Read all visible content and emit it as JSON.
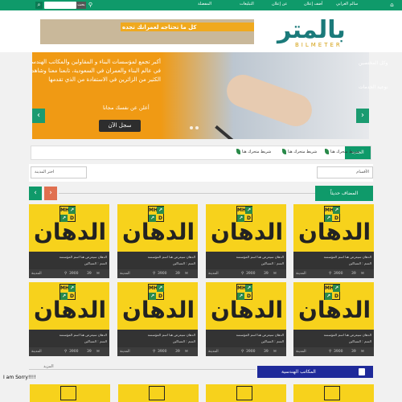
{
  "topbar": {
    "nav": [
      "سالم العرابي",
      "أضف إعلان",
      "عن إعلان",
      "التبليغات",
      "المفضلة"
    ],
    "search_placeholder": "",
    "search_button": "بحث"
  },
  "banner": {
    "text": "كل ما تحتاجه لعمرانك تجده"
  },
  "logo": {
    "main": "بالمتر",
    "sub": "BILMETER"
  },
  "slider": {
    "text": "أكبر تجمع لمؤسسات البناء و المقاولين والمكاتب الهندسية في عالم البناء والعمران في السعودية، تابعنا معنا وشاهد الكثير من الزائرين في الاستفادة من الذي تقدمها",
    "cta_text": "أعلن عن نفسك مجانا",
    "button": "سجل الآن",
    "side_text": "وكل المختصين",
    "side_text2": "نوعية الخدمات"
  },
  "ticker": {
    "label": "الجديد",
    "items": [
      "شريط متحرك هنا",
      "شريط متحرك هنا",
      "شريط متحرك هنا"
    ]
  },
  "filter": {
    "city": "اختر المدينة",
    "section": "الأقسام"
  },
  "section1": {
    "title": "المضاف حديثاً"
  },
  "cards": [
    {
      "title": "الدهان",
      "line1": "الدهان سيعرض هنا اسم المؤسسة",
      "line2": "السم : السباكين",
      "city": "المدينة",
      "views": "3900",
      "likes": "39"
    },
    {
      "title": "الدهان",
      "line1": "الدهان سيعرض هنا اسم المؤسسة",
      "line2": "السم : السباكين",
      "city": "المدينة",
      "views": "3900",
      "likes": "39"
    },
    {
      "title": "الدهان",
      "line1": "الدهان سيعرض هنا اسم المؤسسة",
      "line2": "السم : السباكين",
      "city": "المدينة",
      "views": "3900",
      "likes": "39"
    },
    {
      "title": "الدهان",
      "line1": "الدهان سيعرض هنا اسم المؤسسة",
      "line2": "السم : السباكين",
      "city": "المدينة",
      "views": "3900",
      "likes": "39"
    },
    {
      "title": "الدهان",
      "line1": "الدهان سيعرض هنا اسم المؤسسة",
      "line2": "السم : السباكين",
      "city": "المدينة",
      "views": "3900",
      "likes": "39"
    },
    {
      "title": "الدهان",
      "line1": "الدهان سيعرض هنا اسم المؤسسة",
      "line2": "السم : السباكين",
      "city": "المدينة",
      "views": "3900",
      "likes": "39"
    },
    {
      "title": "الدهان",
      "line1": "الدهان سيعرض هنا اسم المؤسسة",
      "line2": "السم : السباكين",
      "city": "المدينة",
      "views": "3900",
      "likes": "39"
    },
    {
      "title": "الدهان",
      "line1": "الدهان سيعرض هنا اسم المؤسسة",
      "line2": "السم : السباكين",
      "city": "المدينة",
      "views": "3900",
      "likes": "39"
    }
  ],
  "mhd": [
    "MH",
    "D"
  ],
  "section2": {
    "title": "المكاتب الهندسية",
    "more": "المزيد"
  },
  "sorry": "I am Sorry!!!!"
}
